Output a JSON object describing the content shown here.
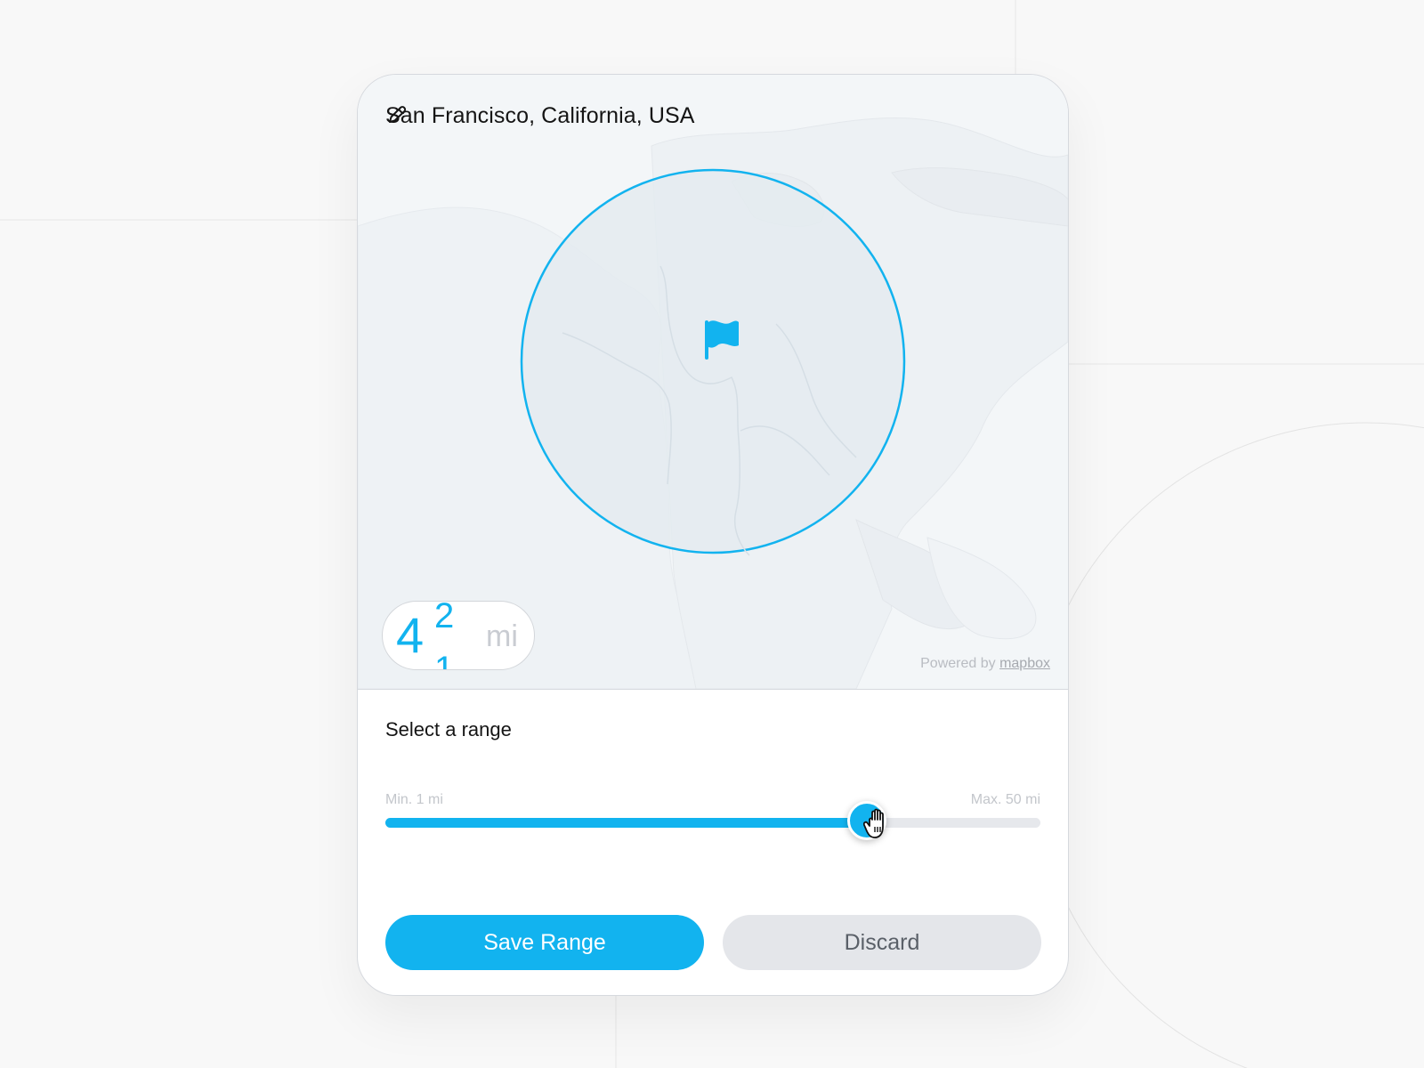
{
  "location": {
    "title": "San Francisco, California, USA",
    "edit_icon": "pencil-icon"
  },
  "map": {
    "marker_icon": "flag-icon",
    "attribution_prefix": "Powered by",
    "attribution_link": "mapbox",
    "accent_color": "#12b3ef"
  },
  "distance": {
    "value": "4",
    "rolling_up": "2",
    "rolling_down": "1",
    "unit": "mi"
  },
  "range": {
    "label": "Select a range",
    "min_label": "Min. 1 mi",
    "max_label": "Max. 50 mi",
    "min": 1,
    "max": 50,
    "fill_fraction": 0.735,
    "cursor_icon": "grab-hand-icon"
  },
  "actions": {
    "save_label": "Save Range",
    "discard_label": "Discard"
  }
}
